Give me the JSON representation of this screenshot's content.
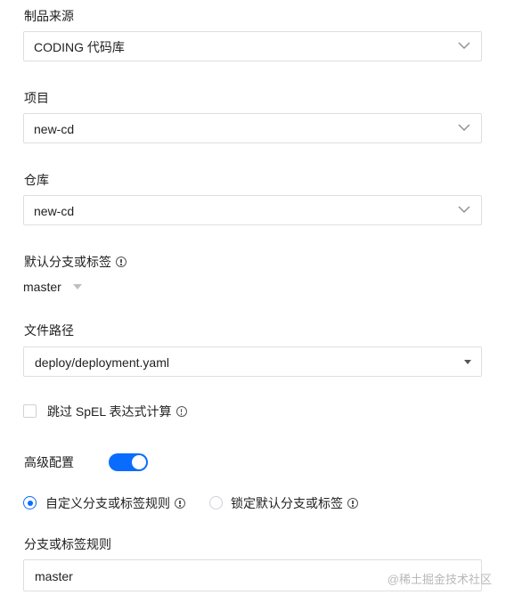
{
  "source": {
    "label": "制品来源",
    "value": "CODING 代码库"
  },
  "project": {
    "label": "项目",
    "value": "new-cd"
  },
  "repo": {
    "label": "仓库",
    "value": "new-cd"
  },
  "branch": {
    "label": "默认分支或标签",
    "value": "master"
  },
  "file_path": {
    "label": "文件路径",
    "value": "deploy/deployment.yaml"
  },
  "skip_spel": {
    "label": "跳过 SpEL 表达式计算",
    "checked": false
  },
  "advanced": {
    "label": "高级配置",
    "enabled": true,
    "accent_color": "#0a6cff"
  },
  "rule_mode": {
    "options": [
      {
        "label": "自定义分支或标签规则",
        "selected": true
      },
      {
        "label": "锁定默认分支或标签",
        "selected": false
      }
    ]
  },
  "rule": {
    "label": "分支或标签规则",
    "value": "master"
  },
  "watermark": "@稀土掘金技术社区",
  "icons": {
    "dropdown": "chevron-down-icon",
    "info": "info-icon",
    "caret": "caret-down-icon"
  }
}
